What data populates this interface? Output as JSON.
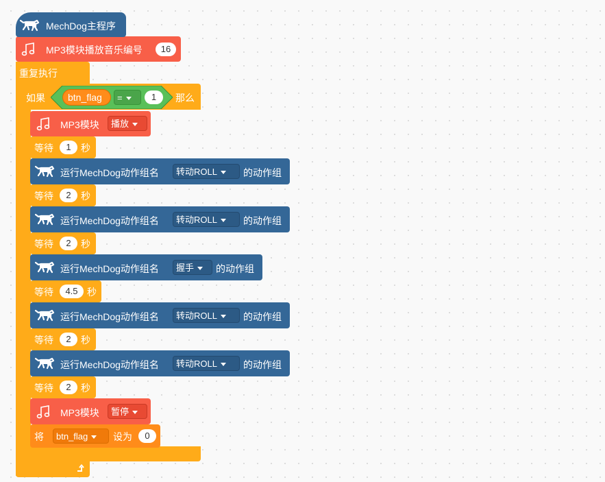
{
  "hat": {
    "title": "MechDog主程序"
  },
  "mp3_play_number": {
    "label": "MP3模块播放音乐编号",
    "value": "16"
  },
  "repeat": {
    "label": "重复执行"
  },
  "if_block": {
    "if_label": "如果",
    "variable": "btn_flag",
    "operator": "=",
    "value": "1",
    "then_label": "那么"
  },
  "mp3_play": {
    "label": "MP3模块",
    "option": "播放"
  },
  "wait_label": "等待",
  "sec_label": "秒",
  "wait1": {
    "value": "1"
  },
  "action_prefix": "运行MechDog动作组名",
  "action_suffix": "的动作组",
  "action1": {
    "option": "转动ROLL"
  },
  "wait2": {
    "value": "2"
  },
  "action2": {
    "option": "转动ROLL"
  },
  "wait3": {
    "value": "2"
  },
  "action3": {
    "option": "握手"
  },
  "wait4": {
    "value": "4.5"
  },
  "action4": {
    "option": "转动ROLL"
  },
  "wait5": {
    "value": "2"
  },
  "action5": {
    "option": "转动ROLL"
  },
  "wait6": {
    "value": "2"
  },
  "mp3_pause": {
    "label": "MP3模块",
    "option": "暂停"
  },
  "set_var": {
    "label": "将",
    "variable": "btn_flag",
    "to_label": "设为",
    "value": "0"
  },
  "icons": {
    "dog": "mechdog-icon",
    "music": "music-note-icon",
    "loop": "loop-arrow-icon"
  },
  "colors": {
    "control": "#ffab19",
    "mp3": "#f85f48",
    "mechdog": "#346797",
    "operator": "#59c059",
    "variable": "#ff8c1a"
  }
}
